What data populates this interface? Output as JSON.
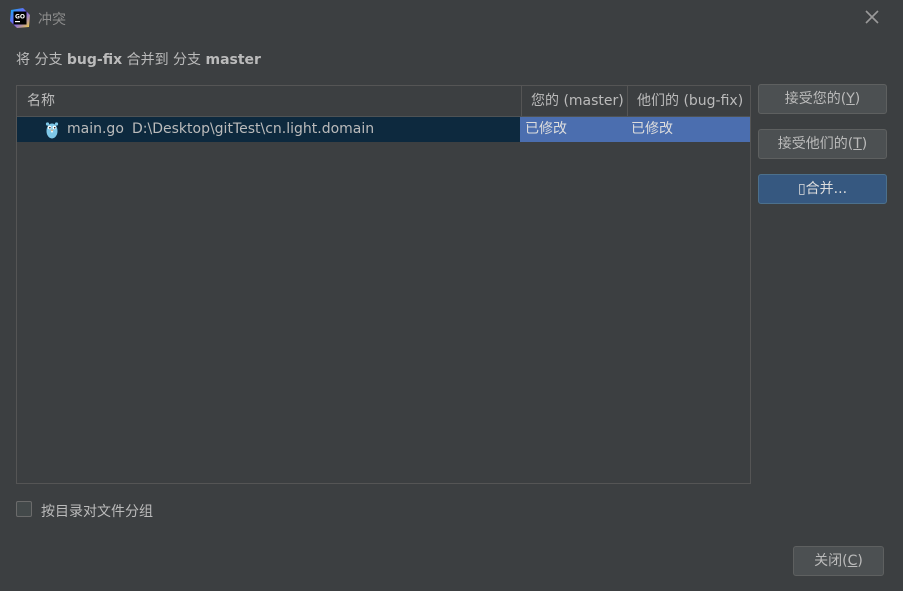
{
  "window": {
    "title": "冲突",
    "app_icon": "goland-icon",
    "close_icon": "close-icon"
  },
  "subtitle": {
    "prefix": "将 分支 ",
    "source_branch": "bug-fix",
    "middle": " 合并到 分支 ",
    "target_branch": "master"
  },
  "table": {
    "columns": {
      "name": "名称",
      "ours": "您的 (master)",
      "theirs": "他们的 (bug-fix)"
    },
    "rows": [
      {
        "icon": "gopher-file-icon",
        "file": "main.go",
        "path": "D:\\Desktop\\gitTest\\cn.light.domain",
        "ours": "已修改",
        "theirs": "已修改"
      }
    ]
  },
  "buttons": {
    "accept_yours": "接受您的(Y)",
    "accept_yours_main": "接受您的(",
    "accept_yours_mnemonic": "Y",
    "accept_yours_tail": ")",
    "accept_theirs": "接受他们的(T)",
    "accept_theirs_main": "接受他们的(",
    "accept_theirs_mnemonic": "T",
    "accept_theirs_tail": ")",
    "merge": "合并...",
    "merge_glyph": "▯",
    "close": "关闭(C)",
    "close_main": "关闭(",
    "close_mnemonic": "C",
    "close_tail": ")"
  },
  "options": {
    "group_by_directory_label": "按目录对文件分组",
    "group_by_directory_checked": false
  },
  "colors": {
    "background": "#3c3f41",
    "selected_row": "#0d293e",
    "status_cell": "#4b6eaf",
    "default_button": "#365880"
  }
}
